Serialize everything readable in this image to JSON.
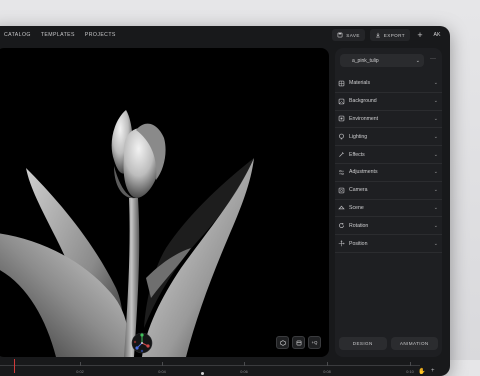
{
  "topbar": {
    "nav": [
      "CATALOG",
      "TEMPLATES",
      "PROJECTS"
    ],
    "save_label": "SAVE",
    "export_label": "EXPORT",
    "add_label": "+",
    "user_initials": "AK"
  },
  "viewport": {
    "tools": [
      "cube-outline",
      "frame",
      "+Q"
    ],
    "subject": "tulip"
  },
  "panel": {
    "asset_name": "a_pink_tulip",
    "more_label": "···",
    "sections": [
      {
        "label": "Materials",
        "icon": "materials-icon"
      },
      {
        "label": "Background",
        "icon": "background-icon"
      },
      {
        "label": "Environment",
        "icon": "environment-icon"
      },
      {
        "label": "Lighting",
        "icon": "lighting-icon"
      },
      {
        "label": "Effects",
        "icon": "effects-icon"
      },
      {
        "label": "Adjustments",
        "icon": "adjustments-icon"
      },
      {
        "label": "Camera",
        "icon": "camera-icon"
      },
      {
        "label": "Scene",
        "icon": "scene-icon"
      },
      {
        "label": "Rotation",
        "icon": "rotation-icon"
      },
      {
        "label": "Position",
        "icon": "position-icon"
      }
    ],
    "design_label": "DESIGN",
    "animation_label": "ANIMATION"
  },
  "timeline": {
    "labels": [
      "0:02",
      "0:04",
      "0:06",
      "0:08",
      "0:10"
    ]
  },
  "colors": {
    "background": "#18191b",
    "panel": "#1e1f22",
    "playhead": "#d03a3a"
  }
}
